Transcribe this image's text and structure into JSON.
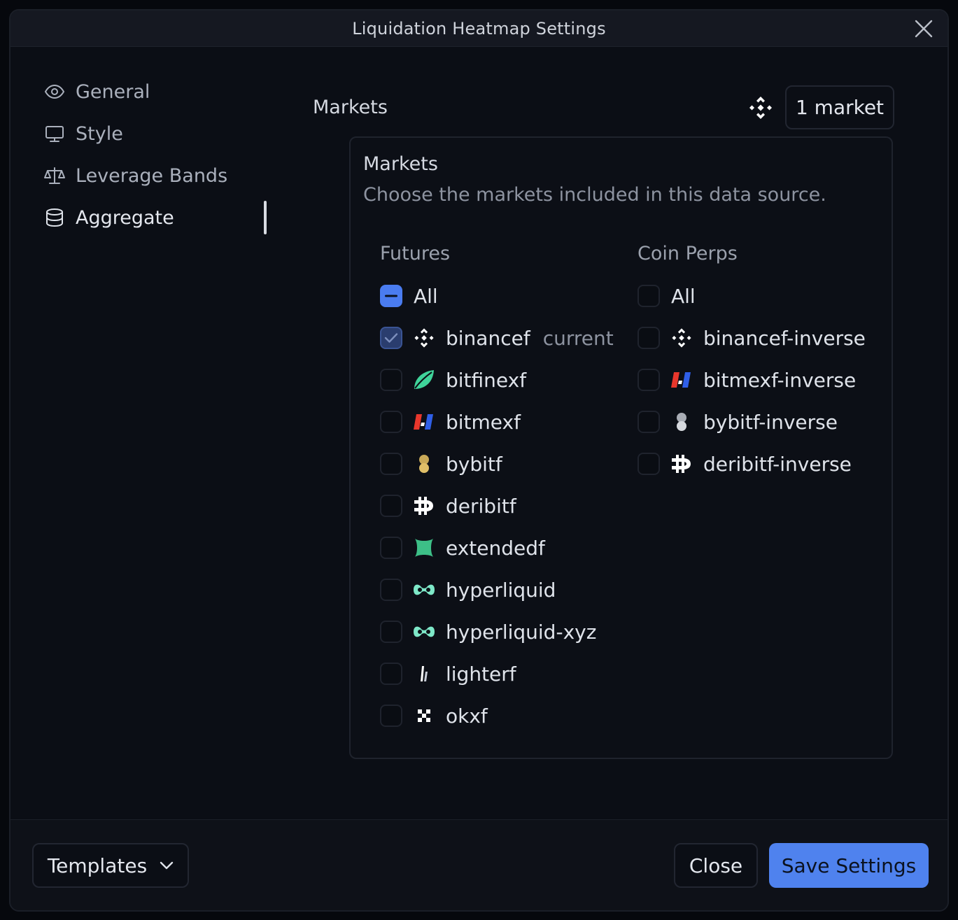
{
  "dialog": {
    "title": "Liquidation Heatmap Settings"
  },
  "sidebar": {
    "items": [
      {
        "label": "General",
        "icon": "eye-icon"
      },
      {
        "label": "Style",
        "icon": "monitor-icon"
      },
      {
        "label": "Leverage Bands",
        "icon": "scale-icon"
      },
      {
        "label": "Aggregate",
        "icon": "database-icon",
        "active": true
      }
    ]
  },
  "markets_section": {
    "title": "Markets",
    "selected_logo": "binance-icon",
    "count_label": "1 market"
  },
  "markets_panel": {
    "title": "Markets",
    "description": "Choose the markets included in this data source.",
    "futures": {
      "title": "Futures",
      "all_label": "All",
      "all_state": "indeterminate",
      "items": [
        {
          "name": "binancef",
          "logo": "binance-icon",
          "checked": true,
          "tag": "current"
        },
        {
          "name": "bitfinexf",
          "logo": "bitfinex-icon",
          "checked": false
        },
        {
          "name": "bitmexf",
          "logo": "bitmex-icon",
          "checked": false
        },
        {
          "name": "bybitf",
          "logo": "bybit-icon",
          "checked": false
        },
        {
          "name": "deribitf",
          "logo": "deribit-icon",
          "checked": false
        },
        {
          "name": "extendedf",
          "logo": "extended-icon",
          "checked": false
        },
        {
          "name": "hyperliquid",
          "logo": "hyperliquid-icon",
          "checked": false
        },
        {
          "name": "hyperliquid-xyz",
          "logo": "hyperliquid-icon",
          "checked": false
        },
        {
          "name": "lighterf",
          "logo": "lighter-icon",
          "checked": false
        },
        {
          "name": "okxf",
          "logo": "okx-icon",
          "checked": false
        }
      ]
    },
    "coin_perps": {
      "title": "Coin Perps",
      "all_label": "All",
      "all_state": "unchecked",
      "items": [
        {
          "name": "binancef-inverse",
          "logo": "binance-icon",
          "checked": false
        },
        {
          "name": "bitmexf-inverse",
          "logo": "bitmex-icon",
          "checked": false
        },
        {
          "name": "bybitf-inverse",
          "logo": "bybit-gray-icon",
          "checked": false
        },
        {
          "name": "deribitf-inverse",
          "logo": "deribit-icon",
          "checked": false
        }
      ]
    }
  },
  "footer": {
    "templates_label": "Templates",
    "close_label": "Close",
    "save_label": "Save Settings"
  },
  "colors": {
    "accent": "#4f82ee",
    "background": "#0b0e15"
  }
}
